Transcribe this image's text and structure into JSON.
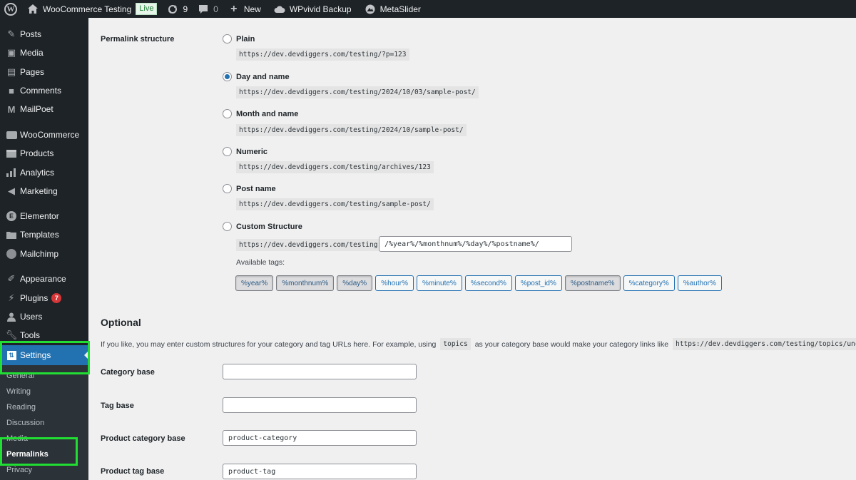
{
  "adminbar": {
    "site_name": "WooCommerce Testing",
    "live_badge": "Live",
    "updates_count": "9",
    "comments_count": "0",
    "new_label": "New",
    "wpvivid_label": "WPvivid Backup",
    "metaslider_label": "MetaSlider"
  },
  "sidebar": {
    "items": [
      {
        "label": "Posts",
        "icon": "pin-icon"
      },
      {
        "label": "Media",
        "icon": "media-icon"
      },
      {
        "label": "Pages",
        "icon": "pages-icon"
      },
      {
        "label": "Comments",
        "icon": "comment-icon"
      },
      {
        "label": "MailPoet",
        "icon": "mailpoet-icon"
      },
      {
        "label": "WooCommerce",
        "icon": "woocommerce-icon"
      },
      {
        "label": "Products",
        "icon": "archive-icon"
      },
      {
        "label": "Analytics",
        "icon": "bar-chart-icon"
      },
      {
        "label": "Marketing",
        "icon": "megaphone-icon"
      },
      {
        "label": "Elementor",
        "icon": "elementor-icon"
      },
      {
        "label": "Templates",
        "icon": "folder-icon"
      },
      {
        "label": "Mailchimp",
        "icon": "mailchimp-icon"
      },
      {
        "label": "Appearance",
        "icon": "brush-icon"
      },
      {
        "label": "Plugins",
        "icon": "plugin-icon",
        "badge": "7"
      },
      {
        "label": "Users",
        "icon": "user-icon"
      },
      {
        "label": "Tools",
        "icon": "wrench-icon"
      },
      {
        "label": "Settings",
        "icon": "settings-icon"
      }
    ],
    "submenu": [
      "General",
      "Writing",
      "Reading",
      "Discussion",
      "Media",
      "Permalinks",
      "Privacy"
    ]
  },
  "permalink": {
    "label": "Permalink structure",
    "options": [
      {
        "label": "Plain",
        "example": "https://dev.devdiggers.com/testing/?p=123",
        "checked": false
      },
      {
        "label": "Day and name",
        "example": "https://dev.devdiggers.com/testing/2024/10/03/sample-post/",
        "checked": true
      },
      {
        "label": "Month and name",
        "example": "https://dev.devdiggers.com/testing/2024/10/sample-post/",
        "checked": false
      },
      {
        "label": "Numeric",
        "example": "https://dev.devdiggers.com/testing/archives/123",
        "checked": false
      },
      {
        "label": "Post name",
        "example": "https://dev.devdiggers.com/testing/sample-post/",
        "checked": false
      },
      {
        "label": "Custom Structure",
        "example": "https://dev.devdiggers.com/testing",
        "checked": false
      }
    ],
    "custom_value": "/%year%/%monthnum%/%day%/%postname%/",
    "available_tags_label": "Available tags:",
    "tags": [
      {
        "label": "%year%",
        "active": true
      },
      {
        "label": "%monthnum%",
        "active": true
      },
      {
        "label": "%day%",
        "active": true
      },
      {
        "label": "%hour%",
        "active": false
      },
      {
        "label": "%minute%",
        "active": false
      },
      {
        "label": "%second%",
        "active": false
      },
      {
        "label": "%post_id%",
        "active": false
      },
      {
        "label": "%postname%",
        "active": true
      },
      {
        "label": "%category%",
        "active": false
      },
      {
        "label": "%author%",
        "active": false
      }
    ]
  },
  "optional": {
    "heading": "Optional",
    "desc_part1": "If you like, you may enter custom structures for your category and tag URLs here. For example, using",
    "desc_code1": "topics",
    "desc_part2": "as your category base would make your category links like",
    "desc_code2": "https://dev.devdiggers.com/testing/topics/uncategorized/",
    "fields": [
      {
        "label": "Category base",
        "value": ""
      },
      {
        "label": "Tag base",
        "value": ""
      },
      {
        "label": "Product category base",
        "value": "product-category"
      },
      {
        "label": "Product tag base",
        "value": "product-tag"
      }
    ]
  },
  "colors": {
    "accent": "#2271b1",
    "highlight_annotation": "#22dd33",
    "adminbar_bg": "#1d2327"
  }
}
